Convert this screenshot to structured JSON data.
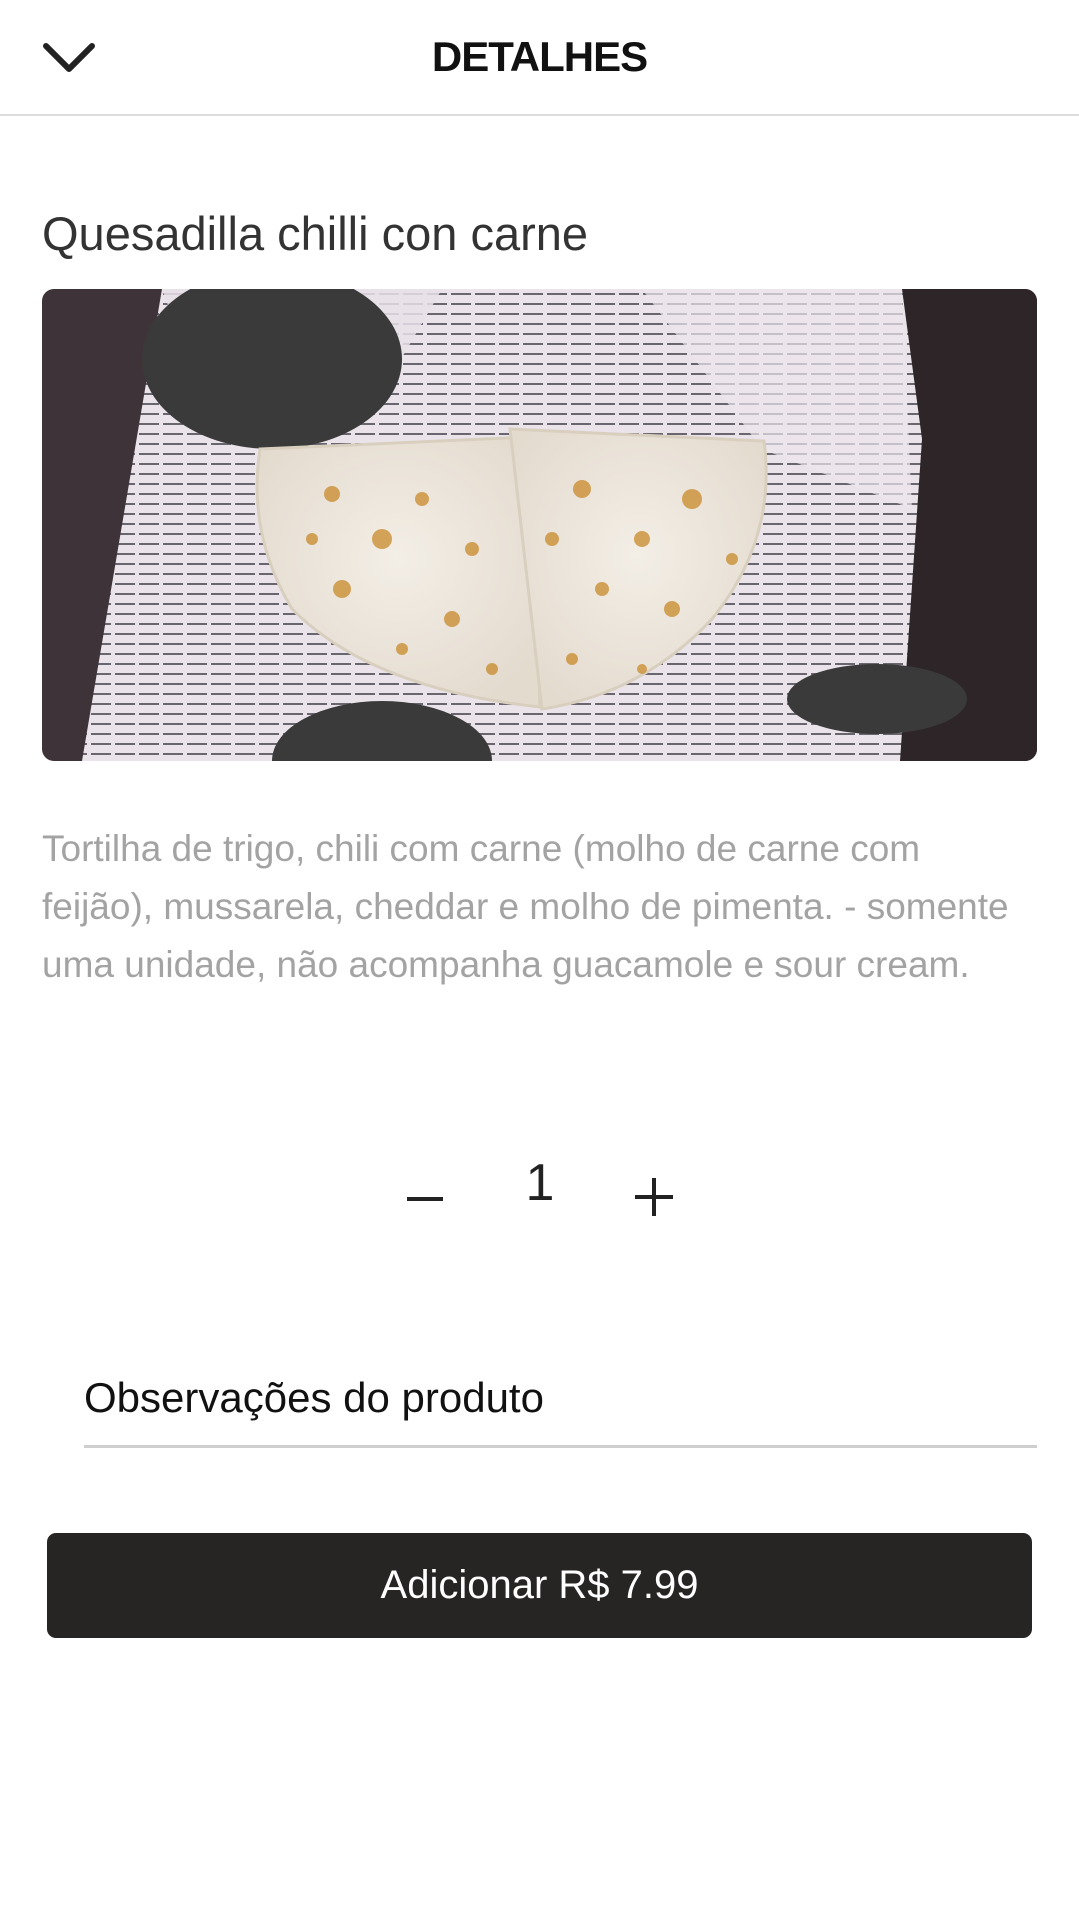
{
  "header": {
    "title": "DETALHES",
    "back_icon": "chevron-down-icon"
  },
  "product": {
    "name": "Quesadilla chilli con carne",
    "image_alt": "quesadilla",
    "description": "Tortilha de trigo, chili com carne (molho de carne com feijão), mussarela, cheddar e molho de pimenta. - somente uma unidade, não acompanha guacamole e sour cream."
  },
  "quantity": {
    "value": "1",
    "minus_icon": "minus-icon",
    "plus_icon": "plus-icon"
  },
  "notes": {
    "placeholder": "Observações do produto",
    "value": ""
  },
  "cart": {
    "add_label": "Adicionar R$ 7.99"
  },
  "colors": {
    "button_bg": "#272424",
    "description_text": "#a3a3a3",
    "divider": "#dcdcdc"
  }
}
